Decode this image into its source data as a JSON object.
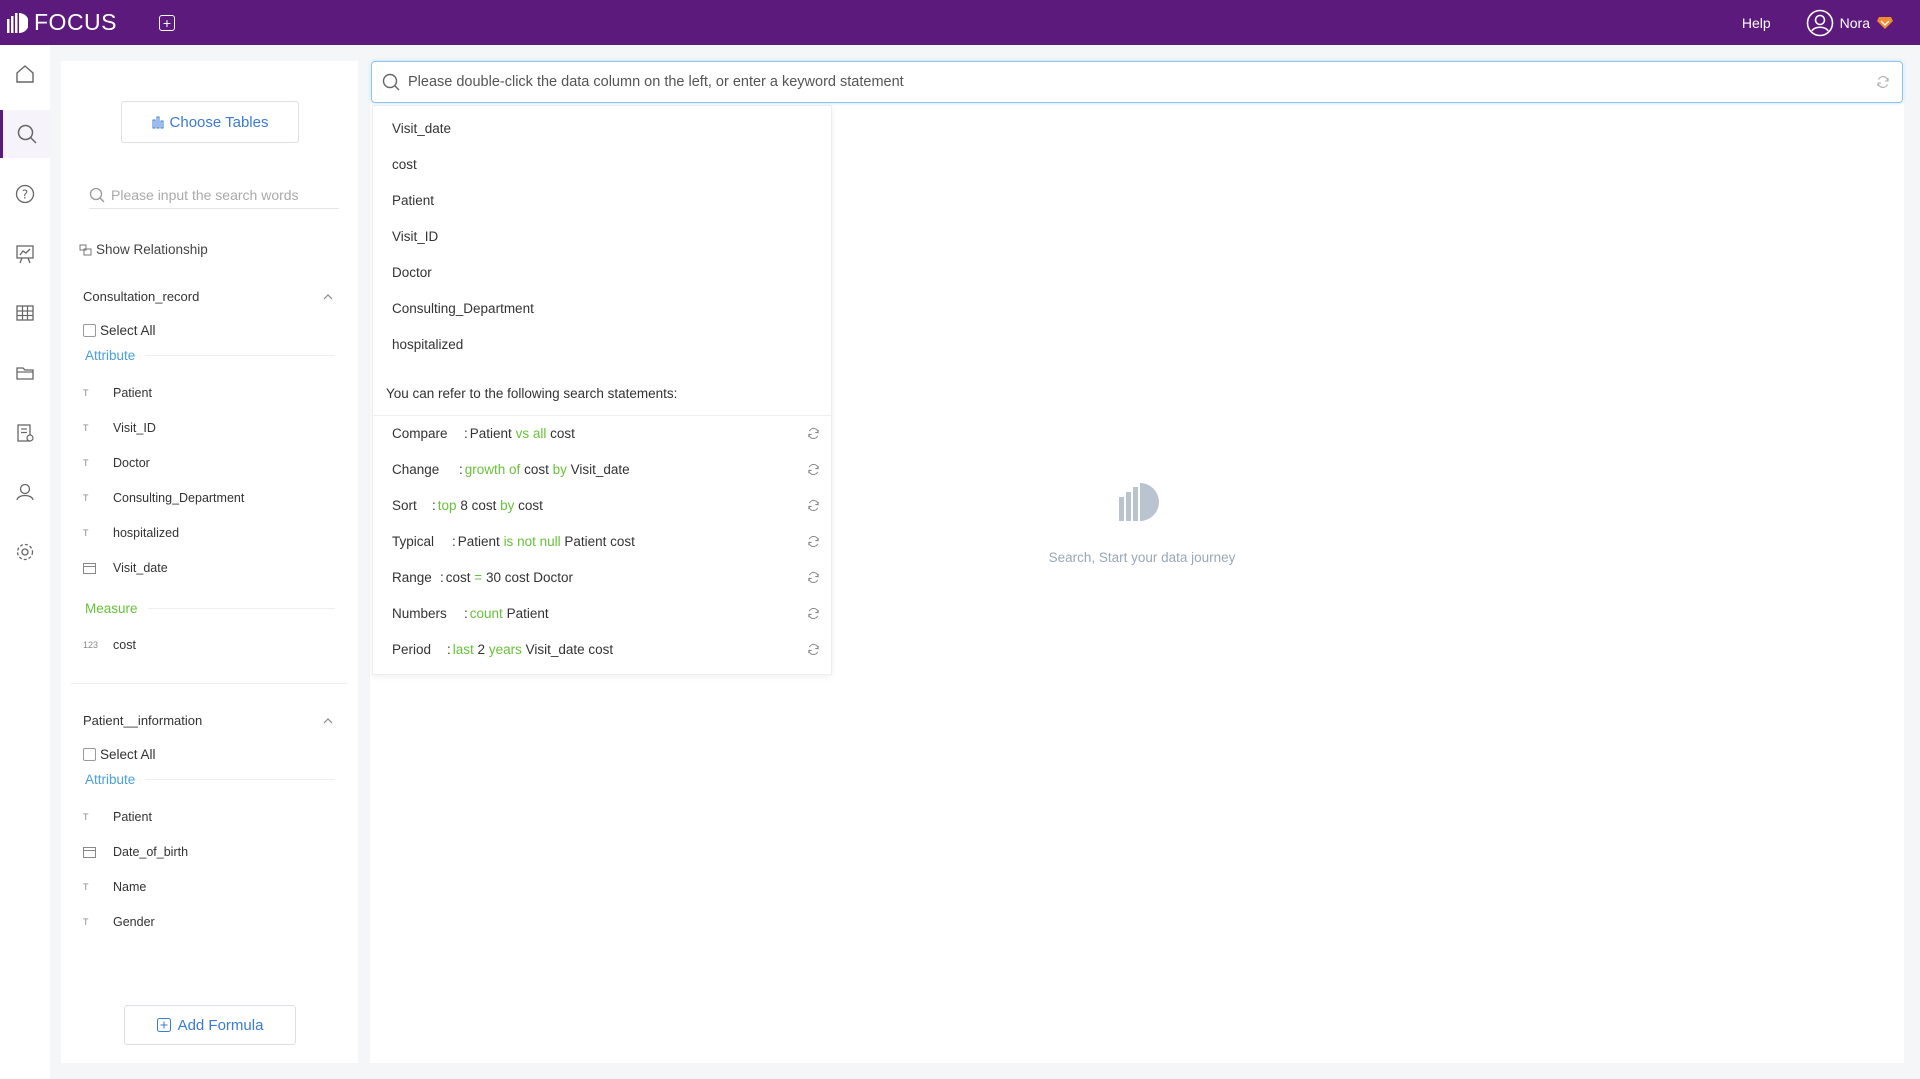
{
  "header": {
    "app_name": "FOCUS",
    "help_label": "Help",
    "user_name": "Nora"
  },
  "panel": {
    "choose_tables_label": "Choose Tables",
    "search_placeholder": "Please input the search words",
    "show_relationship_label": "Show Relationship",
    "add_formula_label": "Add Formula",
    "tables": [
      {
        "name": "Consultation_record",
        "select_all_label": "Select All",
        "attribute_label": "Attribute",
        "attributes": [
          {
            "name": "Patient",
            "type_icon": "text-type-icon"
          },
          {
            "name": "Visit_ID",
            "type_icon": "text-type-icon"
          },
          {
            "name": "Doctor",
            "type_icon": "text-type-icon"
          },
          {
            "name": "Consulting_Department",
            "type_icon": "text-type-icon"
          },
          {
            "name": "hospitalized",
            "type_icon": "text-type-icon"
          },
          {
            "name": "Visit_date",
            "type_icon": "date-type-icon"
          }
        ],
        "measure_label": "Measure",
        "measures": [
          {
            "name": "cost",
            "type_icon": "number-type-icon",
            "type_text": "123"
          }
        ]
      },
      {
        "name": "Patient__information",
        "select_all_label": "Select All",
        "attribute_label": "Attribute",
        "attributes": [
          {
            "name": "Patient",
            "type_icon": "text-type-icon"
          },
          {
            "name": "Date_of_birth",
            "type_icon": "date-type-icon"
          },
          {
            "name": "Name",
            "type_icon": "text-type-icon"
          },
          {
            "name": "Gender",
            "type_icon": "text-type-icon"
          }
        ]
      }
    ]
  },
  "search": {
    "placeholder": "Please double-click the data column on the left, or enter a keyword statement"
  },
  "dropdown": {
    "columns": [
      "Visit_date",
      "cost",
      "Patient",
      "Visit_ID",
      "Doctor",
      "Consulting_Department",
      "hospitalized"
    ],
    "hint": "You can refer to the following search statements:",
    "examples": [
      {
        "label": "Compare",
        "parts": [
          [
            "Patient",
            false
          ],
          [
            "vs",
            true
          ],
          [
            "all",
            true
          ],
          [
            "cost",
            false
          ]
        ]
      },
      {
        "label": "Change",
        "parts": [
          [
            "growth of",
            true
          ],
          [
            "cost",
            false
          ],
          [
            "by",
            true
          ],
          [
            "Visit_date",
            false
          ]
        ]
      },
      {
        "label": "Sort",
        "parts": [
          [
            "top",
            true
          ],
          [
            "8 cost",
            false
          ],
          [
            "by",
            true
          ],
          [
            "cost",
            false
          ]
        ]
      },
      {
        "label": "Typical",
        "parts": [
          [
            "Patient",
            false
          ],
          [
            "is not null",
            true
          ],
          [
            "Patient cost",
            false
          ]
        ]
      },
      {
        "label": "Range",
        "parts": [
          [
            "cost",
            false
          ],
          [
            "=",
            true
          ],
          [
            "30 cost Doctor",
            false
          ]
        ]
      },
      {
        "label": "Numbers",
        "parts": [
          [
            "count",
            true
          ],
          [
            "Patient",
            false
          ]
        ]
      },
      {
        "label": "Period",
        "parts": [
          [
            "last",
            true
          ],
          [
            "2",
            false
          ],
          [
            "years",
            true
          ],
          [
            "Visit_date cost",
            false
          ]
        ]
      }
    ]
  },
  "empty_state": {
    "message": "Search, Start your data journey"
  },
  "colors": {
    "topbar": "#5c1a7c",
    "accent_blue": "#3a7bd5",
    "keyword_green": "#67c23a",
    "attribute_blue": "#4a9fe0",
    "measure_green": "#67c23a"
  }
}
